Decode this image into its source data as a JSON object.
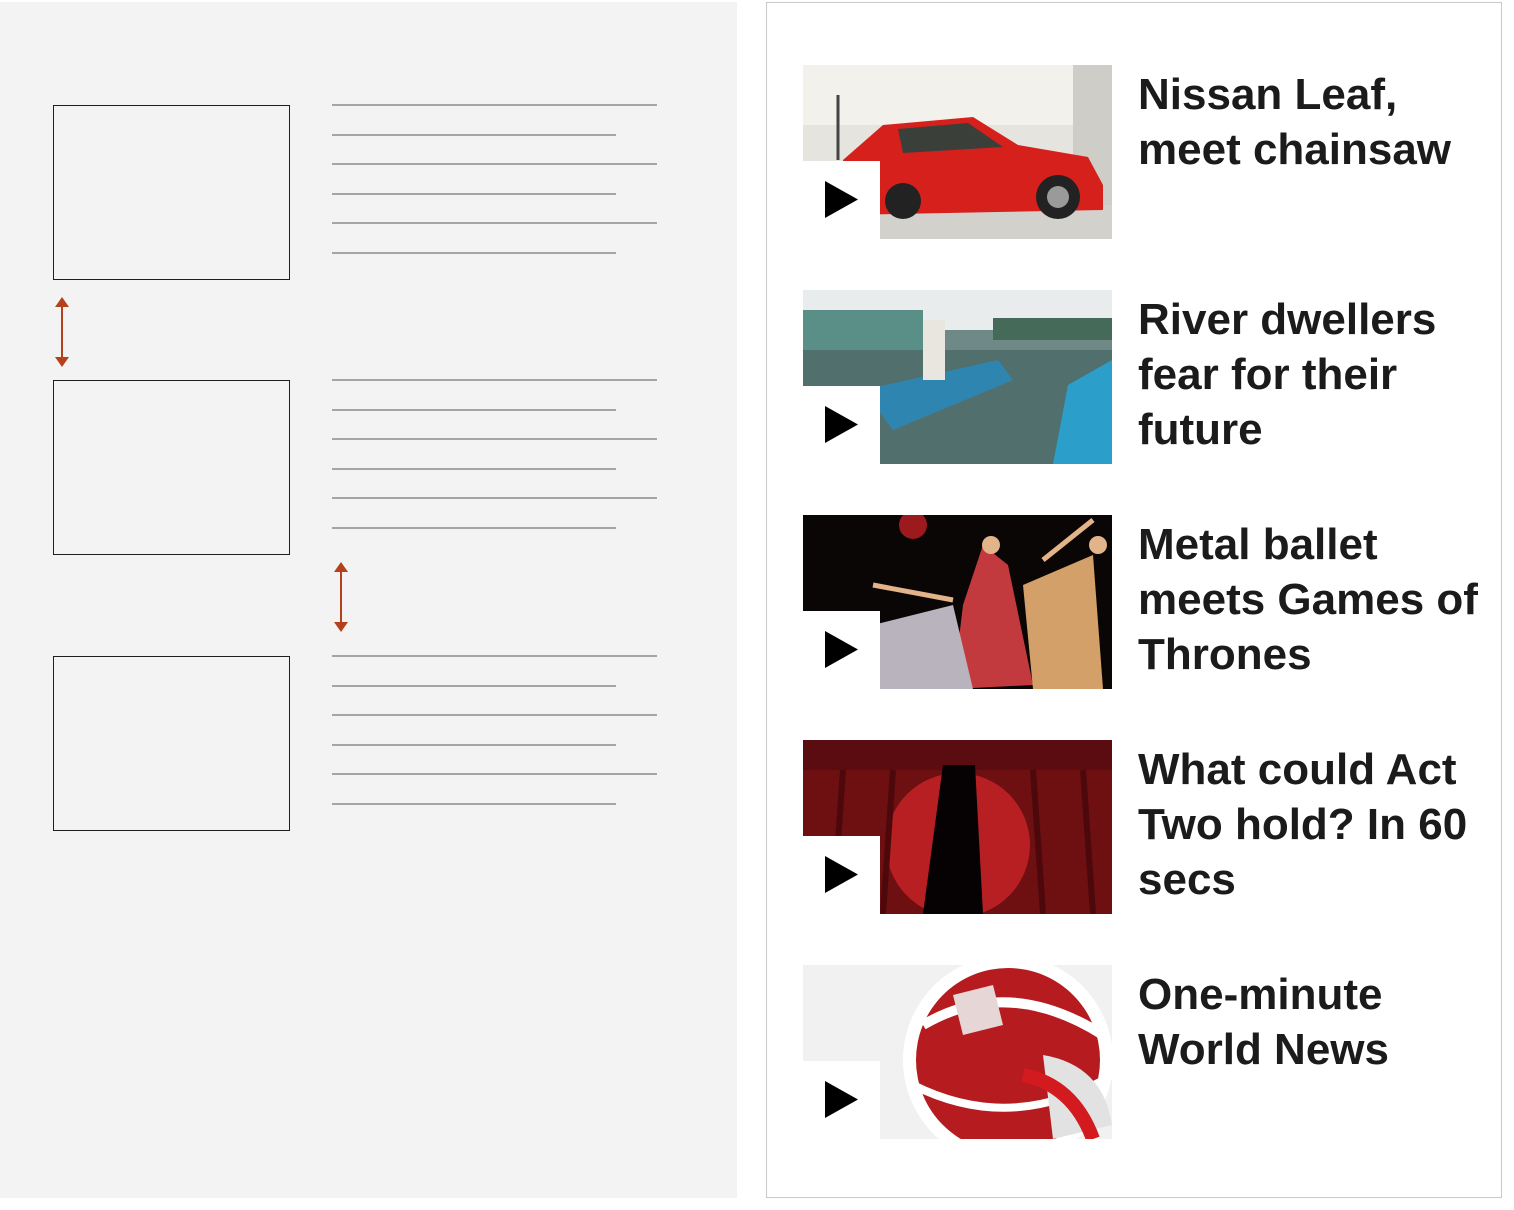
{
  "colors": {
    "wireframe_bg": "#f2f3f2",
    "wireframe_line": "#a4a6a5",
    "spacing_arrow": "#b5401c",
    "headline_text": "#1b1b1b",
    "play_icon": "#000000"
  },
  "wireframe": {
    "boxes": 3,
    "lines_per_box": 6,
    "icons": [
      "vertical-spacing-arrow",
      "vertical-spacing-arrow"
    ]
  },
  "videos": [
    {
      "headline": "Nissan Leaf, meet chainsaw",
      "thumb_subject": "red car",
      "icon": "play-icon"
    },
    {
      "headline": "River dwellers fear for their future",
      "thumb_subject": "river boats",
      "icon": "play-icon"
    },
    {
      "headline": "Metal ballet meets Games of Thrones",
      "thumb_subject": "ballet dancers",
      "icon": "play-icon"
    },
    {
      "headline": "What could Act Two hold? In 60 secs",
      "thumb_subject": "red theatre curtain",
      "icon": "play-icon"
    },
    {
      "headline": "One-minute World News",
      "thumb_subject": "red globe graphic",
      "icon": "play-icon"
    }
  ]
}
